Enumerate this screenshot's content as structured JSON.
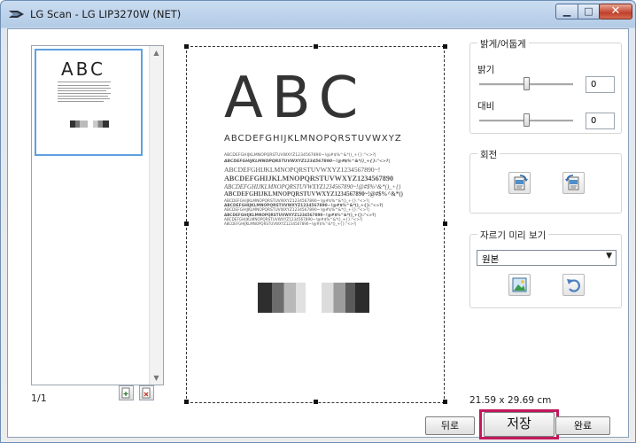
{
  "window": {
    "title": "LG Scan - LG LIP3270W (NET)",
    "minimize_glyph": "▁",
    "maximize_glyph": "□",
    "close_glyph": "✕"
  },
  "thumbnails": {
    "page_count": "1/1",
    "thumb_text": "ABC"
  },
  "preview": {
    "big_text": "ABC",
    "alphabet_line": "ABCDEFGHIJKLMNOPQRSTUVWXYZ",
    "sample_lines": [
      "ABCDEFGHIJKLMNOPQRSTUVWXYZ1234567890~!@#$%^&*()_+{}:\"<>?|",
      "ABCDEFGHIJKLMNOPQRSTUVWXYZ1234567890~!@#$%^&*()_+{}:\"<>?|",
      "ABCDEFGHIJKLMNOPQRSTUVWXYZ1234567890~!",
      "ABCDEFGHIJKLMNOPQRSTUVWXYZ1234567890",
      "ABCDEFGHIJKLMNOPQRSTUVWXYZ1234567890~!@#$%^&*()_+{}",
      "ABCDEFGHIJKLMNOPQRSTUVWXYZ1234567890~!@#$%^&*()",
      "ABCDEFGHIJKLMNOPQRSTUVWXYZ1234567890~!@#$%^&*()_+{}:\"<>?|",
      "ABCDEFGHIJKLMNOPQRSTUVWXYZ1234567890~!@#$%^&*()_+{}:\"<>?|",
      "ABCDEFGHIJKLMNOPQRSTUVWXYZ1234567890~!@#$%^&*()_+{}:\"<>?|",
      "ABCDEFGHIJKLMNOPQRSTUVWXYZ1234567890~!@#$%^&*()_+{}:\"<>?|",
      "ABCDEFGHIJKLMNOPQRSTUVWXYZ1234567890~!@#$%^&*()_+{}:\"<>?|",
      "ABCDEFGHIJKLMNOPQRSTUVWXYZ1234567890~!@#$%^&*()_+{}:\"<>?|"
    ]
  },
  "adjust": {
    "group_title": "밝게/어둡게",
    "brightness_label": "밝기",
    "brightness_value": "0",
    "contrast_label": "대비",
    "contrast_value": "0",
    "brightness_level": 0.5,
    "contrast_level": 0.5
  },
  "rotate": {
    "group_title": "회전"
  },
  "crop": {
    "group_title": "자르기 미리 보기",
    "selected_option": "원본"
  },
  "page_size": "21.59 x 29.69 cm",
  "buttons": {
    "back": "뒤로",
    "save": "저장",
    "finish": "완료"
  },
  "colors": {
    "highlight": "#c2185b",
    "thumb_selected_border": "#5ea0e0"
  }
}
